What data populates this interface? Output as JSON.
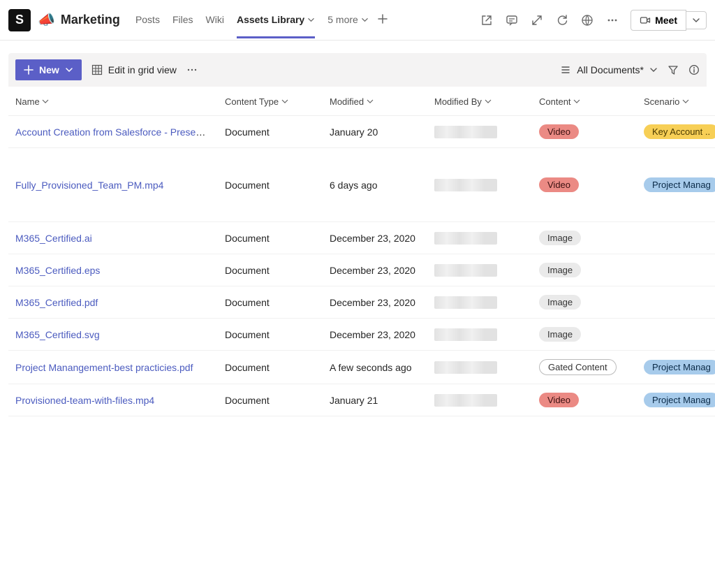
{
  "header": {
    "badge_letter": "S",
    "team_icon": "📣",
    "team_name": "Marketing",
    "tabs": [
      {
        "label": "Posts"
      },
      {
        "label": "Files"
      },
      {
        "label": "Wiki"
      },
      {
        "label": "Assets Library",
        "active": true,
        "has_chevron": true
      },
      {
        "label": "5 more",
        "has_chevron": true
      }
    ],
    "meet_label": "Meet"
  },
  "toolbar": {
    "new_label": "New",
    "edit_grid_label": "Edit in grid view",
    "view_label": "All Documents*"
  },
  "columns": {
    "name": "Name",
    "ctype": "Content Type",
    "modified": "Modified",
    "modifiedby": "Modified By",
    "content": "Content",
    "scenario": "Scenario"
  },
  "rows": [
    {
      "name": "Account Creation from Salesforce - Present...",
      "ctype": "Document",
      "modified": "January 20",
      "content": {
        "label": "Video",
        "class": "pill-video"
      },
      "scenario": {
        "label": "Key Account ..",
        "class": "pill-key"
      },
      "tall": false
    },
    {
      "name": "Fully_Provisioned_Team_PM.mp4",
      "ctype": "Document",
      "modified": "6 days ago",
      "content": {
        "label": "Video",
        "class": "pill-video"
      },
      "scenario": {
        "label": "Project Manag",
        "class": "pill-pm"
      },
      "tall": true
    },
    {
      "name": "M365_Certified.ai",
      "ctype": "Document",
      "modified": "December 23, 2020",
      "content": {
        "label": "Image",
        "class": "pill-image"
      },
      "scenario": null,
      "tall": false
    },
    {
      "name": "M365_Certified.eps",
      "ctype": "Document",
      "modified": "December 23, 2020",
      "content": {
        "label": "Image",
        "class": "pill-image"
      },
      "scenario": null,
      "tall": false
    },
    {
      "name": "M365_Certified.pdf",
      "ctype": "Document",
      "modified": "December 23, 2020",
      "content": {
        "label": "Image",
        "class": "pill-image"
      },
      "scenario": null,
      "tall": false
    },
    {
      "name": "M365_Certified.svg",
      "ctype": "Document",
      "modified": "December 23, 2020",
      "content": {
        "label": "Image",
        "class": "pill-image"
      },
      "scenario": null,
      "tall": false
    },
    {
      "name": "Project Manangement-best practicies.pdf",
      "ctype": "Document",
      "modified": "A few seconds ago",
      "content": {
        "label": "Gated Content",
        "class": "pill-gated"
      },
      "scenario": {
        "label": "Project Manag",
        "class": "pill-pm"
      },
      "tall": false
    },
    {
      "name": "Provisioned-team-with-files.mp4",
      "ctype": "Document",
      "modified": "January 21",
      "content": {
        "label": "Video",
        "class": "pill-video"
      },
      "scenario": {
        "label": "Project Manag",
        "class": "pill-pm"
      },
      "tall": false
    }
  ]
}
